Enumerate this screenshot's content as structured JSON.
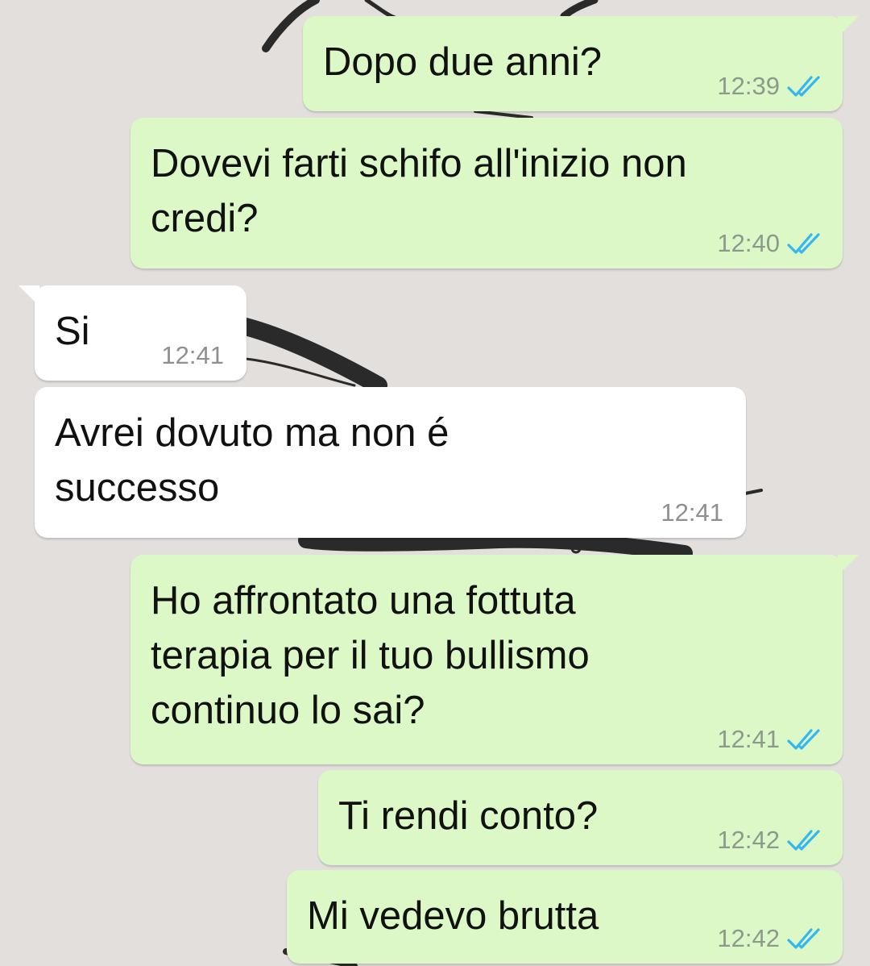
{
  "theme": {
    "outgoing_bubble": "#dcf8c6",
    "incoming_bubble": "#ffffff",
    "read_tick_color": "#34b7f1",
    "wallpaper": "#e2dfdd"
  },
  "messages": [
    {
      "direction": "out",
      "lines": [
        "Dopo due anni?"
      ],
      "time": "12:39",
      "status": "read-double-check-icon"
    },
    {
      "direction": "out",
      "lines": [
        "Dovevi farti schifo all'inizio non",
        "credi?"
      ],
      "time": "12:40",
      "status": "read-double-check-icon"
    },
    {
      "direction": "in",
      "lines": [
        "Si"
      ],
      "time": "12:41"
    },
    {
      "direction": "in",
      "lines": [
        "Avrei dovuto ma non é",
        "successo"
      ],
      "time": "12:41"
    },
    {
      "direction": "out",
      "lines": [
        "Ho affrontato una fottuta",
        "terapia per il tuo bullismo",
        "continuo lo sai?"
      ],
      "time": "12:41",
      "status": "read-double-check-icon"
    },
    {
      "direction": "out",
      "lines": [
        "Ti rendi conto?"
      ],
      "time": "12:42",
      "status": "read-double-check-icon"
    },
    {
      "direction": "out",
      "lines": [
        "Mi vedevo brutta"
      ],
      "time": "12:42",
      "status": "read-double-check-icon"
    }
  ]
}
